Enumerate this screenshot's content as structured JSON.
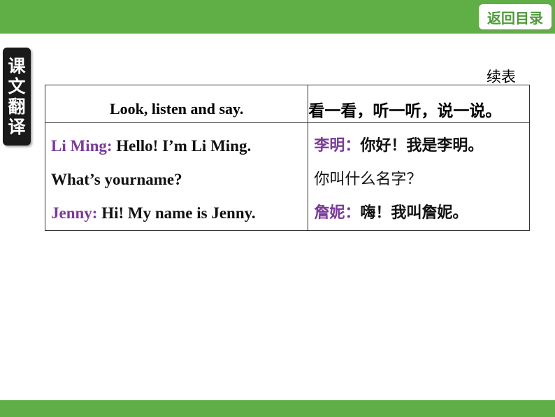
{
  "nav": {
    "back_to_contents": "返回目录"
  },
  "side_tab": {
    "chars": [
      "课",
      "文",
      "翻",
      "译"
    ]
  },
  "table": {
    "continued_label": "续表",
    "header": {
      "english": "Look, listen and say.",
      "chinese": "看一看，听一听，说一说。"
    },
    "english_lines": [
      {
        "speaker": "Li Ming:",
        "text": " Hello! I’m Li Ming."
      },
      {
        "speaker": "",
        "text": "What’s yourname?"
      },
      {
        "speaker": "Jenny:",
        "text": " Hi! My name is Jenny."
      }
    ],
    "chinese_lines": [
      {
        "speaker": "李明：",
        "text": "你好！我是李明。"
      },
      {
        "speaker": "",
        "text": "你叫什么名字？"
      },
      {
        "speaker": "詹妮：",
        "text": "嗨！我叫詹妮。"
      }
    ]
  },
  "colors": {
    "bar": "#5fae46",
    "speaker": "#7a3b99"
  }
}
